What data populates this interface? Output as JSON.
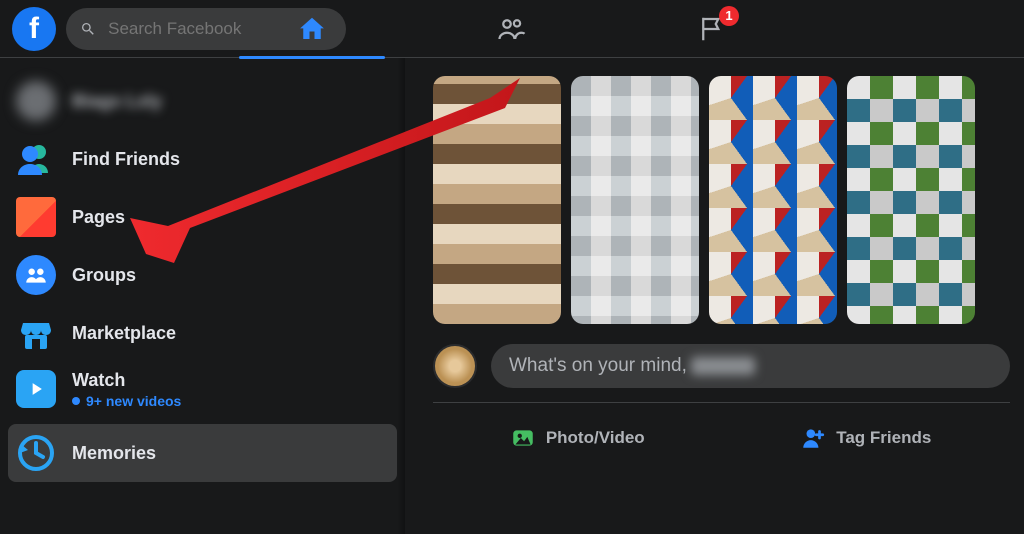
{
  "search": {
    "placeholder": "Search Facebook"
  },
  "topnav": {
    "home_active": true,
    "notifications_badge": "1"
  },
  "sidebar": {
    "profile": {
      "name": "Biags Lsly"
    },
    "find_friends": {
      "label": "Find Friends"
    },
    "pages": {
      "label": "Pages"
    },
    "groups": {
      "label": "Groups"
    },
    "marketplace": {
      "label": "Marketplace"
    },
    "watch": {
      "label": "Watch",
      "sub": "9+ new videos"
    },
    "memories": {
      "label": "Memories"
    }
  },
  "composer": {
    "prompt_prefix": "What's on your mind, ",
    "photo_video_label": "Photo/Video",
    "tag_friends_label": "Tag Friends"
  }
}
